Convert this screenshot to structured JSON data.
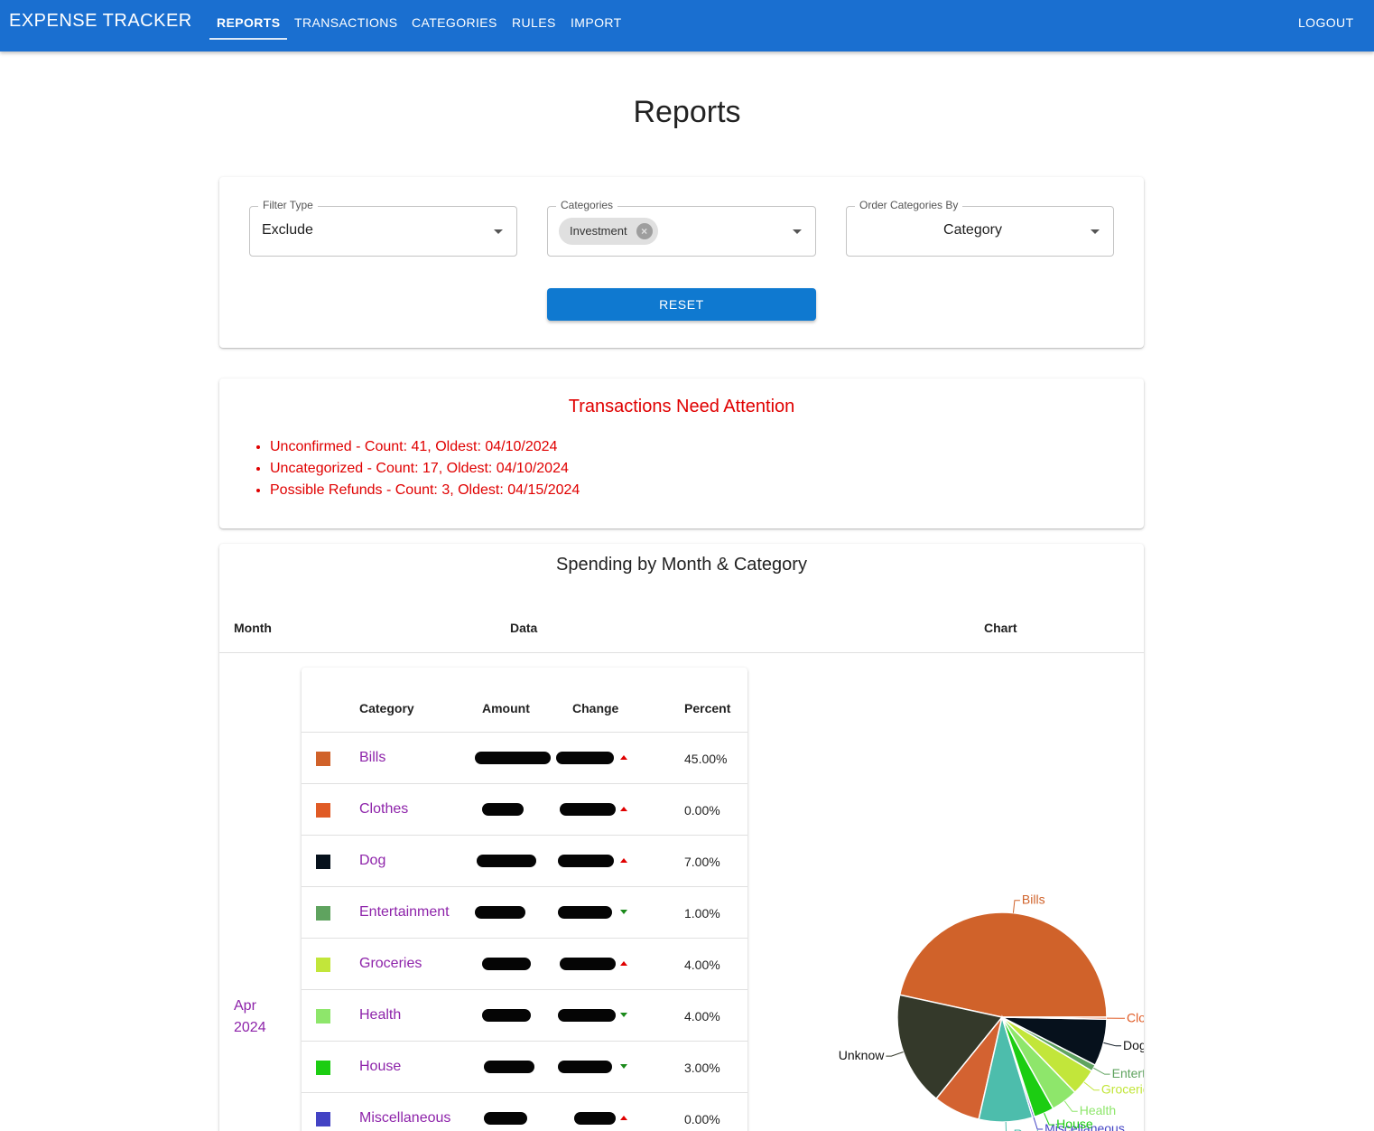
{
  "appbar": {
    "brand": "EXPENSE TRACKER",
    "nav": [
      "REPORTS",
      "TRANSACTIONS",
      "CATEGORIES",
      "RULES",
      "IMPORT"
    ],
    "active": "REPORTS",
    "logout": "LOGOUT"
  },
  "page": {
    "title": "Reports"
  },
  "filters": {
    "filter_type": {
      "label": "Filter Type",
      "value": "Exclude"
    },
    "categories": {
      "label": "Categories",
      "chips": [
        "Investment"
      ]
    },
    "order_by": {
      "label": "Order Categories By",
      "value": "Category"
    },
    "reset_label": "RESET"
  },
  "attention": {
    "title": "Transactions Need Attention",
    "items": [
      "Unconfirmed - Count: 41, Oldest: 04/10/2024",
      "Uncategorized - Count: 17, Oldest: 04/10/2024",
      "Possible Refunds - Count: 3, Oldest: 04/15/2024"
    ]
  },
  "spending": {
    "title": "Spending by Month & Category",
    "headers": {
      "month": "Month",
      "data": "Data",
      "chart": "Chart"
    },
    "month_label_1": "Apr",
    "month_label_2": "2024",
    "table_headers": {
      "category": "Category",
      "amount": "Amount",
      "change": "Change",
      "percent": "Percent"
    },
    "rows": [
      {
        "category": "Bills",
        "color": "#d0622a",
        "percent": "45.00%",
        "trend": "up"
      },
      {
        "category": "Clothes",
        "color": "#e05b25",
        "percent": "0.00%",
        "trend": "up"
      },
      {
        "category": "Dog",
        "color": "#06111c",
        "percent": "7.00%",
        "trend": "up"
      },
      {
        "category": "Entertainment",
        "color": "#5fa35f",
        "percent": "1.00%",
        "trend": "down"
      },
      {
        "category": "Groceries",
        "color": "#c2e63a",
        "percent": "4.00%",
        "trend": "up"
      },
      {
        "category": "Health",
        "color": "#8ee66b",
        "percent": "4.00%",
        "trend": "down"
      },
      {
        "category": "House",
        "color": "#1ccd12",
        "percent": "3.00%",
        "trend": "down"
      },
      {
        "category": "Miscellaneous",
        "color": "#4343c4",
        "percent": "0.00%",
        "trend": "up"
      }
    ]
  },
  "chart_data": {
    "type": "pie",
    "labels": [
      "Bills",
      "Unknown",
      "",
      "Restaurants",
      "Miscellaneous",
      "House",
      "Health",
      "Groceries",
      "Entertainment",
      "Dog",
      "Clothes"
    ],
    "visible_labels": [
      "Bills",
      "Unknow",
      "",
      "Restaurants",
      "Miscellaneous",
      "House",
      "Health",
      "Groceries",
      "Entertainment",
      "Dog",
      "Clothes"
    ],
    "values": [
      45,
      17,
      7,
      8,
      0.3,
      3,
      4,
      4,
      1,
      7,
      0.3
    ],
    "colors": [
      "#d0622a",
      "#34392a",
      "#d36231",
      "#4dbdac",
      "#4343c4",
      "#1ccd12",
      "#8ee66b",
      "#c2e63a",
      "#5fa35f",
      "#06111c",
      "#e05b25"
    ]
  }
}
